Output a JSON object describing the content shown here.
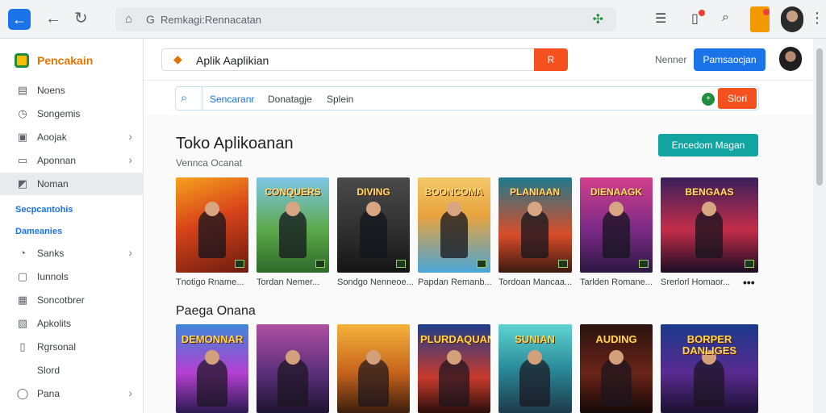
{
  "browser": {
    "address": "Remkagi:Rennacatan",
    "google_mark": "G"
  },
  "sidebar": {
    "brand": "Pencakain",
    "items": [
      {
        "label": "Noens",
        "icon": "book-icon",
        "glyph": "▤",
        "chevron": false,
        "active": false
      },
      {
        "label": "Songemis",
        "icon": "clock-icon",
        "glyph": "◷",
        "chevron": false,
        "active": false
      },
      {
        "label": "Aoojak",
        "icon": "bag-icon",
        "glyph": "▣",
        "chevron": true,
        "active": false
      },
      {
        "label": "Aponnan",
        "icon": "document-icon",
        "glyph": "▭",
        "chevron": true,
        "active": false
      },
      {
        "label": "Noman",
        "icon": "tag-icon",
        "glyph": "◩",
        "chevron": false,
        "active": true
      }
    ],
    "heading1": "Secpcantohis",
    "heading2": "Dameanies",
    "items2": [
      {
        "label": "Sanks",
        "icon": "leaf-icon",
        "glyph": "◔",
        "chevron": true
      },
      {
        "label": "Iunnols",
        "icon": "box-icon",
        "glyph": "▢",
        "chevron": false
      },
      {
        "label": "Soncotbrer",
        "icon": "gift-icon",
        "glyph": "▦",
        "chevron": false
      },
      {
        "label": "Apkolits",
        "icon": "folder-icon",
        "glyph": "▧",
        "chevron": false
      },
      {
        "label": "Rgrsonal",
        "icon": "note-icon",
        "glyph": "▯",
        "chevron": false
      },
      {
        "label": "Slord",
        "icon": "",
        "glyph": "",
        "chevron": false
      },
      {
        "label": "Pana",
        "icon": "account-icon",
        "glyph": "◯",
        "chevron": true
      }
    ]
  },
  "header": {
    "search_value": "Aplik Aaplikian",
    "search_button": "R",
    "link": "Nenner",
    "primary_button": "Pamsaocjan"
  },
  "filter": {
    "chips": [
      "Sencaranr",
      "Donatagje",
      "Splein"
    ],
    "dot": "+",
    "button": "Slori"
  },
  "section1": {
    "title": "Toko Aplikoanan",
    "subtitle": "Vennca Ocanat",
    "button": "Encedom Magan",
    "cards": [
      {
        "art": "",
        "caption": "Tnotigo Rname...",
        "bg": "linear-gradient(160deg,#f6a21c 0%,#d8431a 45%,#6b1b0f 100%)"
      },
      {
        "art": "CONQUERS",
        "caption": "Tordan Nemer...",
        "bg": "linear-gradient(180deg,#7fc6e8 0%,#5ca84a 55%,#2d6a2a 100%)"
      },
      {
        "art": "DIVING",
        "caption": "Sondgo Nenneoe...",
        "bg": "linear-gradient(180deg,#4a4a4a 0%,#2d2d2d 60%,#151515 100%)"
      },
      {
        "art": "BOONCOMA",
        "caption": "Papdan Remanb...",
        "bg": "linear-gradient(180deg,#f3c86a 0%,#e8a33e 40%,#4aa5d8 100%)"
      },
      {
        "art": "PLANIAAN",
        "caption": "Tordoan Mancaa...",
        "bg": "linear-gradient(180deg,#1f7a8c 0%,#d94c2a 60%,#3a1a10 100%)"
      },
      {
        "art": "DIENAAGK",
        "caption": "Tarlden Romane...",
        "bg": "linear-gradient(180deg,#d23f8b 0%,#7b2a86 55%,#2b1740 100%)"
      },
      {
        "art": "BENGAAS",
        "caption": "Srerlorl Homaor...",
        "bg": "linear-gradient(180deg,#3a1f5c 0%,#c42d4a 55%,#1a0d24 100%)"
      }
    ],
    "more": "•••"
  },
  "section2": {
    "title": "Paega Onana",
    "cards": [
      {
        "art": "DEMONNAR",
        "bg": "linear-gradient(180deg,#3d86d8 0%,#b53fd0 55%,#2a1a50 100%)"
      },
      {
        "art": "",
        "bg": "linear-gradient(180deg,#b04fa2 0%,#5a2f7a 55%,#1e1430 100%)"
      },
      {
        "art": "",
        "bg": "linear-gradient(180deg,#f4b33a 0%,#c5621c 55%,#3a1e0c 100%)"
      },
      {
        "art": "PLURDAQUAN",
        "bg": "linear-gradient(180deg,#1d3d8a 0%,#c93a2c 60%,#2a0f0c 100%)"
      },
      {
        "art": "SUNIAN",
        "bg": "linear-gradient(180deg,#5fd4d0 0%,#2a8a9a 50%,#1d3a4a 100%)"
      },
      {
        "art": "AUDING",
        "bg": "linear-gradient(180deg,#2a1410 0%,#6a2418 55%,#140808 100%)"
      },
      {
        "art": "BORPER DANLIGES",
        "bg": "linear-gradient(180deg,#1a3a8a 0%,#5a2a90 55%,#1a1030 100%)"
      }
    ]
  }
}
